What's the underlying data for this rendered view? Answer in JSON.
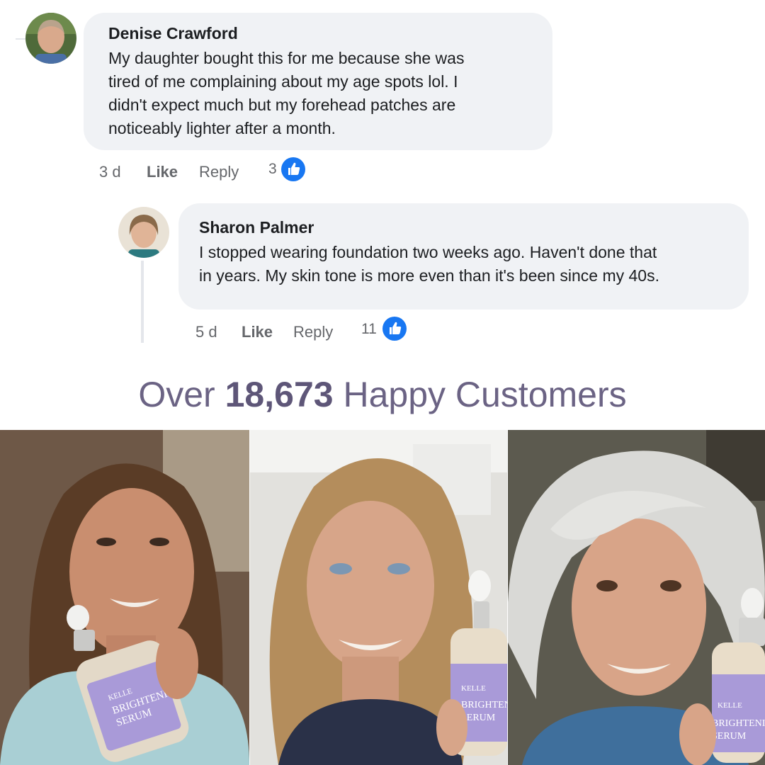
{
  "comments": [
    {
      "author": "Denise Crawford",
      "text_lines": [
        "My daughter bought this for me because she was",
        "tired of me complaining about my age spots lol. I",
        "didn't expect much but my forehead patches are",
        "noticeably lighter after a month."
      ],
      "time": "3 d",
      "like_label": "Like",
      "reply_label": "Reply",
      "reaction_count": "3",
      "avatar_icon": "user-avatar"
    },
    {
      "author": "Sharon Palmer",
      "text_lines": [
        "I stopped wearing foundation two weeks ago. Haven't done that",
        "in years. My skin tone is more even than it's been since my 40s."
      ],
      "time": "5 d",
      "like_label": "Like",
      "reply_label": "Reply",
      "reaction_count": "11",
      "avatar_icon": "user-avatar"
    }
  ],
  "headline": {
    "prefix": "Over",
    "count": "18,673",
    "suffix": "Happy Customers"
  },
  "photos": [
    {
      "brand": "KELLE",
      "product_line1": "BRIGHTENING",
      "product_line2": "SERUM"
    },
    {
      "brand": "KELLE",
      "product_line1": "BRIGHTENIN",
      "product_line2": "SERUM"
    },
    {
      "brand": "KELLE",
      "product_line1": "BRIGHTENING",
      "product_line2": "SERUM"
    }
  ],
  "colors": {
    "bubble": "#f0f2f5",
    "like_blue": "#1877f2",
    "headline": "#6b6384",
    "serum_label": "#a99ad8"
  }
}
